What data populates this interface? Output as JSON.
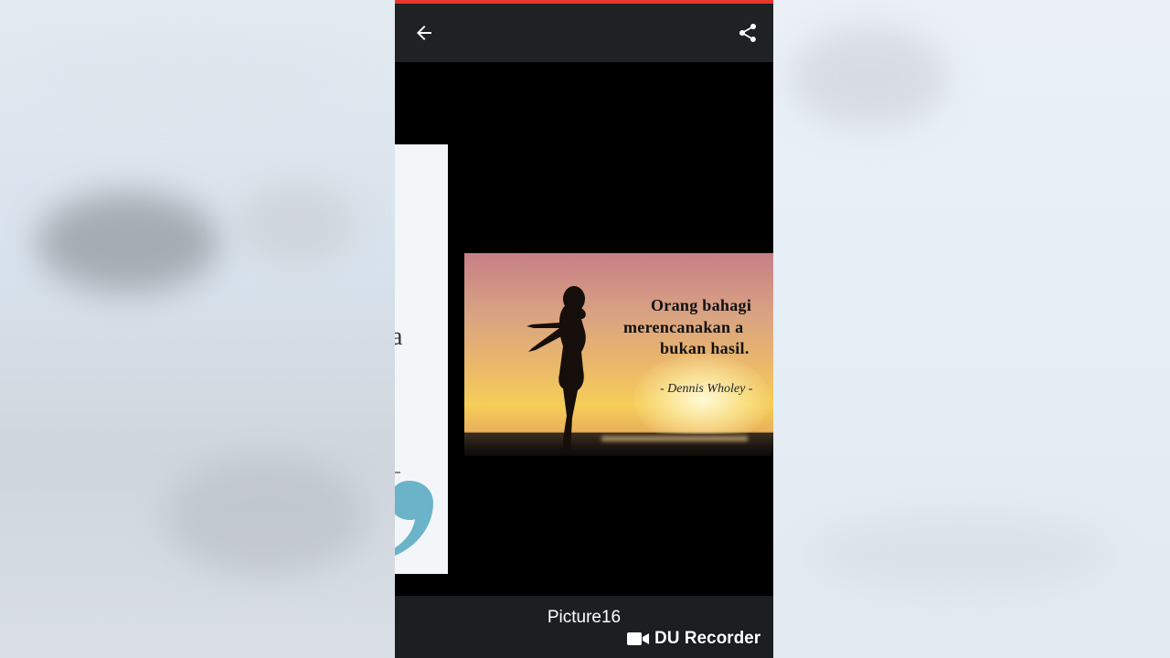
{
  "toolbar": {
    "back_icon": "arrow-left-icon",
    "share_icon": "share-icon"
  },
  "picture": {
    "quote_lines": [
      "Orang bahagi",
      "merencanakan a",
      "bukan hasil."
    ],
    "author": "- Dennis Wholey -"
  },
  "previous_picture": {
    "fragment": "a"
  },
  "caption": {
    "title": "Picture16"
  },
  "watermark": {
    "label": "DU Recorder",
    "icon": "video-camera-icon"
  },
  "colors": {
    "accent": "#e8382b",
    "toolbar_bg": "#1f2123",
    "caption_bg": "#1c1e20"
  }
}
